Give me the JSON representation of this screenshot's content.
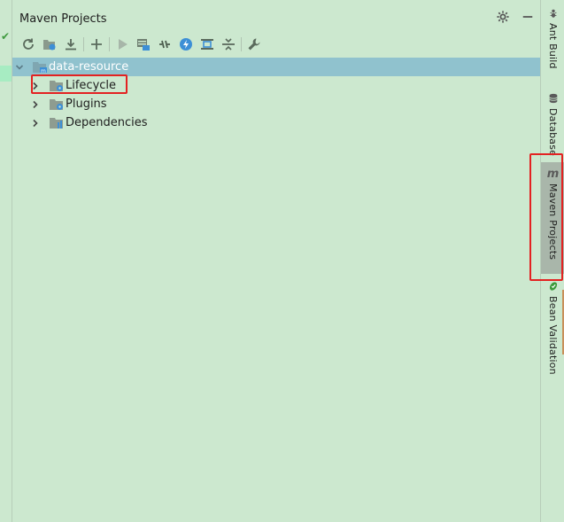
{
  "panel": {
    "title": "Maven Projects"
  },
  "toolbar": {
    "buttons": [
      {
        "icon": "refresh-icon",
        "label": "Reimport All Maven Projects"
      },
      {
        "icon": "generate-sources-icon",
        "label": "Generate Sources and Update Folders"
      },
      {
        "icon": "download-icon",
        "label": "Download Sources and/or Documentation"
      },
      {
        "icon": "add-icon",
        "label": "Add Maven Projects"
      },
      {
        "icon": "run-icon",
        "label": "Run Maven Build"
      },
      {
        "icon": "execute-goal-icon",
        "label": "Execute Maven Goal"
      },
      {
        "icon": "toggle-offline-icon",
        "label": "Toggle Offline Mode"
      },
      {
        "icon": "skip-tests-icon",
        "label": "Toggle Skip Tests Mode"
      },
      {
        "icon": "show-dependencies-icon",
        "label": "Show Dependencies"
      },
      {
        "icon": "collapse-all-icon",
        "label": "Collapse All"
      },
      {
        "icon": "settings-wrench-icon",
        "label": "Maven Settings"
      }
    ]
  },
  "tree": {
    "root": "data-resource",
    "children": [
      "Lifecycle",
      "Plugins",
      "Dependencies"
    ]
  },
  "right_bar": {
    "tabs": [
      "Ant Build",
      "Database",
      "Maven Projects",
      "Bean Validation"
    ]
  }
}
